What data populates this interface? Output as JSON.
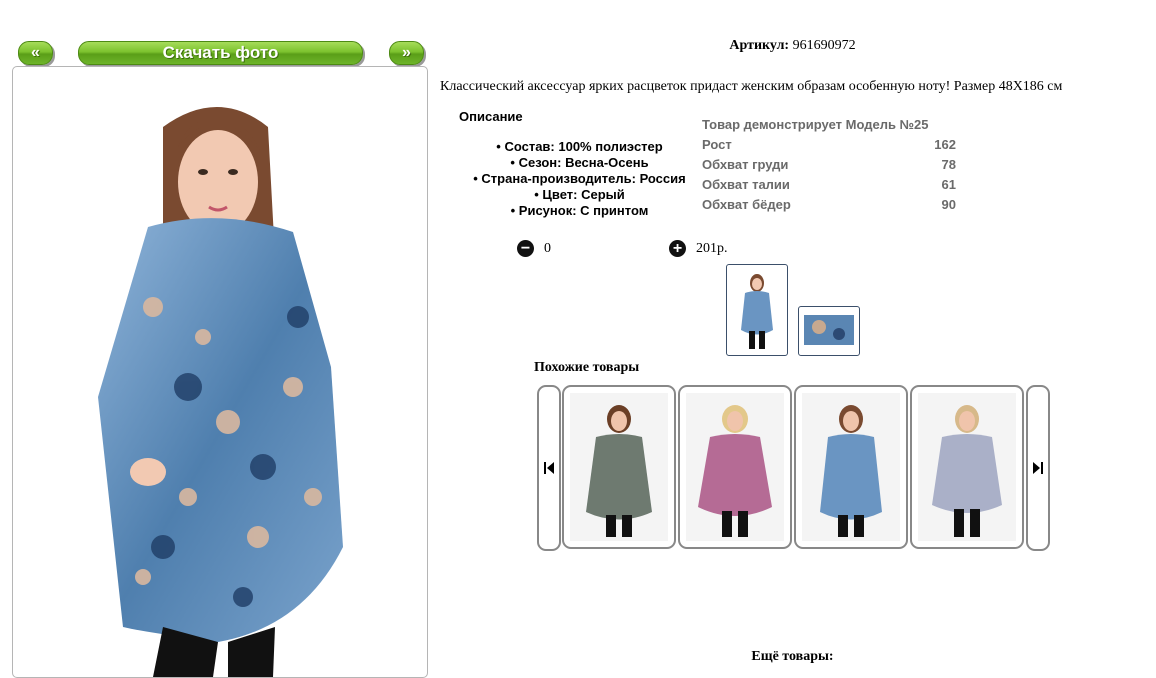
{
  "nav": {
    "prev_label": "«",
    "download_label": "Скачать фото",
    "next_label": "»"
  },
  "product": {
    "sku_label": "Артикул:",
    "sku_value": "961690972",
    "description": "Классический аксессуар ярких расцветок придаст женским образам особенную ноту! Размер 48Х186 см",
    "spec_title": "Описание",
    "specs": [
      "Состав: 100% полиэстер",
      "Сезон: Весна-Осень",
      "Страна-производитель: Россия",
      "Цвет: Серый",
      "Рисунок: С принтом"
    ],
    "model": {
      "header": "Товар демонстрирует Модель №25",
      "rows": [
        {
          "label": "Рост",
          "value": "162"
        },
        {
          "label": "Обхват груди",
          "value": "78"
        },
        {
          "label": "Обхват талии",
          "value": "61"
        },
        {
          "label": "Обхват бёдер",
          "value": "90"
        }
      ]
    },
    "quantity": "0",
    "price": "201р."
  },
  "similar": {
    "title": "Похожие товары",
    "items": [
      {
        "scarf_color": "#6e7a70"
      },
      {
        "scarf_color": "#b56b95"
      },
      {
        "scarf_color": "#6a95c2"
      },
      {
        "scarf_color": "#aab0c8"
      }
    ]
  },
  "more_title": "Ещё товары:",
  "colors": {
    "accent_green": "#7cc22e",
    "scarf_blue": "#6a95c2"
  }
}
